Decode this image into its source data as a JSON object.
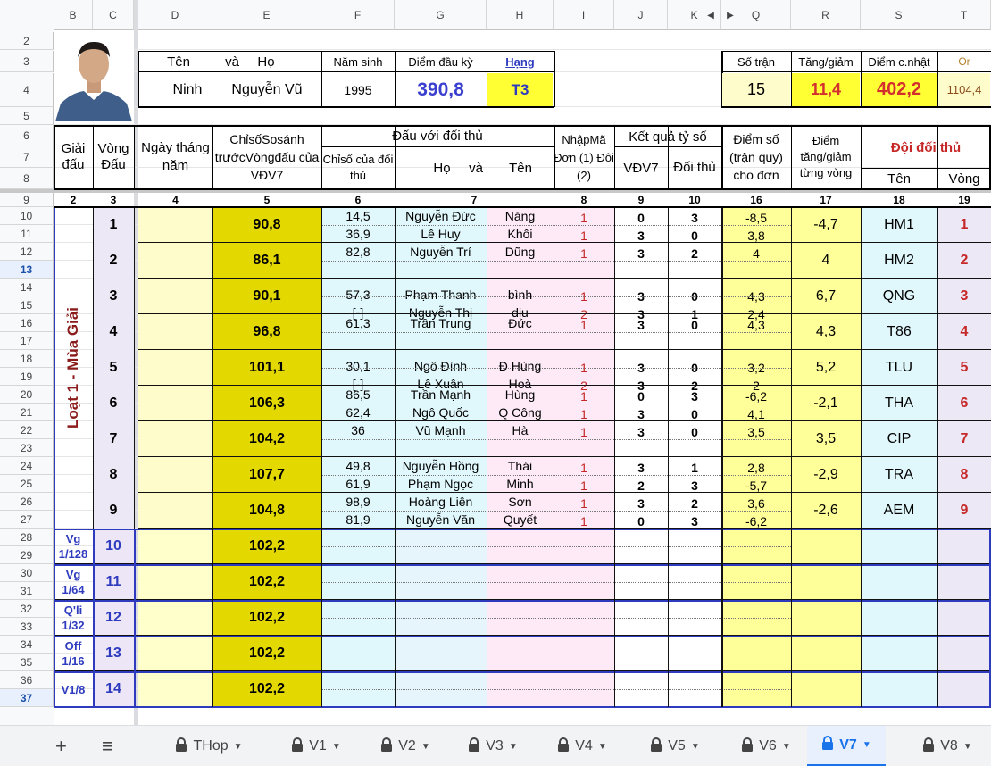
{
  "columns": [
    "B",
    "C",
    "D",
    "E",
    "F",
    "G",
    "H",
    "I",
    "J",
    "K",
    "Q",
    "R",
    "S",
    "T"
  ],
  "rows": [
    "2",
    "3",
    "4",
    "5",
    "6",
    "7",
    "8",
    "9",
    "10",
    "11",
    "12",
    "13",
    "14",
    "15",
    "16",
    "17",
    "18",
    "19",
    "20",
    "21",
    "22",
    "23",
    "24",
    "25",
    "26",
    "27",
    "28",
    "29",
    "30",
    "31",
    "32",
    "33",
    "34",
    "35",
    "36",
    "37"
  ],
  "header": {
    "ten": "Tên",
    "va": "và",
    "ho": "Họ",
    "nam_sinh_label": "Năm sinh",
    "diem_dau_ky_label": "Điểm đầu kỳ",
    "hang_label": "Hạng",
    "first_name": "Ninh",
    "last_name": "Nguyễn Vũ",
    "birth_year": "1995",
    "start_points": "390,8",
    "rank": "T3",
    "so_tran_label": "Số trận",
    "tang_giam_label": "Tăng/giảm",
    "diem_cnhat_label": "Điểm c.nhật",
    "or_label": "Or",
    "so_tran": "15",
    "tang_giam": "11,4",
    "diem_cnhat": "402,2",
    "or_value": "1104,4"
  },
  "table_head": {
    "giai_dau": "Giải đấu",
    "vong_dau": "Vòng Đấu",
    "ngay": "Ngày tháng năm",
    "chiso": "ChỉsốSosánh trướcVòngđấu của VĐV7",
    "dau_voi": "Đấu với đối thủ",
    "chiso_doithu": "Chỉsố của đối thủ",
    "ho": "Họ",
    "va": "và",
    "ten": "Tên",
    "nhapma": "NhậpMã Đơn (1) Đôi (2)",
    "ketqua": "Kết quả tỷ số",
    "vdv7": "VĐV7",
    "doithu": "Đối thủ",
    "diemso": "Điểm số (trận quy) cho đơn",
    "diem_tang": "Điểm tăng/giảm từng vòng",
    "doi_doi_thu": "Đội đối thủ",
    "ten2": "Tên",
    "vong": "Vòng",
    "nums": [
      "2",
      "3",
      "4",
      "5",
      "6",
      "7",
      "8",
      "9",
      "10",
      "16",
      "17",
      "18",
      "19"
    ]
  },
  "season_label": "Loạt 1 - Mùa Giải",
  "rounds": [
    {
      "vong": "1",
      "chiso": "90,8",
      "diem": "-4,7",
      "team": "HM1",
      "vnum": "1",
      "matches": [
        {
          "c": "14,5",
          "ho": "Nguyễn Đức",
          "ten": "Năng",
          "m": "1",
          "a": "0",
          "b": "3",
          "d": "-8,5"
        },
        {
          "c": "36,9",
          "ho": "Lê Huy",
          "ten": "Khôi",
          "m": "1",
          "a": "3",
          "b": "0",
          "d": "3,8"
        }
      ]
    },
    {
      "vong": "2",
      "chiso": "86,1",
      "diem": "4",
      "team": "HM2",
      "vnum": "2",
      "matches": [
        {
          "c": "82,8",
          "ho": "Nguyễn Trí",
          "ten": "Dũng",
          "m": "1",
          "a": "3",
          "b": "2",
          "d": "4"
        }
      ]
    },
    {
      "vong": "3",
      "chiso": "90,1",
      "diem": "6,7",
      "team": "QNG",
      "vnum": "3",
      "matches": [
        {
          "c": "57,3",
          "ho": "Phạm Thanh",
          "ten": "bình",
          "m": "1",
          "a": "3",
          "b": "0",
          "d": "4,3"
        },
        {
          "c": "[-]",
          "ho": "Nguyễn Thị",
          "ten": "dịu",
          "m": "2",
          "a": "3",
          "b": "1",
          "d": "2,4"
        }
      ]
    },
    {
      "vong": "4",
      "chiso": "96,8",
      "diem": "4,3",
      "team": "T86",
      "vnum": "4",
      "matches": [
        {
          "c": "61,3",
          "ho": "Trần Trung",
          "ten": "Đức",
          "m": "1",
          "a": "3",
          "b": "0",
          "d": "4,3"
        }
      ]
    },
    {
      "vong": "5",
      "chiso": "101,1",
      "diem": "5,2",
      "team": "TLU",
      "vnum": "5",
      "matches": [
        {
          "c": "30,1",
          "ho": "Ngô Đình",
          "ten": "Đ Hùng",
          "m": "1",
          "a": "3",
          "b": "0",
          "d": "3,2"
        },
        {
          "c": "[-]",
          "ho": "Lê Xuân",
          "ten": "Hoà",
          "m": "2",
          "a": "3",
          "b": "2",
          "d": "2"
        }
      ]
    },
    {
      "vong": "6",
      "chiso": "106,3",
      "diem": "-2,1",
      "team": "THA",
      "vnum": "6",
      "matches": [
        {
          "c": "86,5",
          "ho": "Trần Mạnh",
          "ten": "Hùng",
          "m": "1",
          "a": "0",
          "b": "3",
          "d": "-6,2"
        },
        {
          "c": "62,4",
          "ho": "Ngô Quốc",
          "ten": "Q Công",
          "m": "1",
          "a": "3",
          "b": "0",
          "d": "4,1"
        }
      ]
    },
    {
      "vong": "7",
      "chiso": "104,2",
      "diem": "3,5",
      "team": "CIP",
      "vnum": "7",
      "matches": [
        {
          "c": "36",
          "ho": "Vũ Mạnh",
          "ten": "Hà",
          "m": "1",
          "a": "3",
          "b": "0",
          "d": "3,5"
        }
      ]
    },
    {
      "vong": "8",
      "chiso": "107,7",
      "diem": "-2,9",
      "team": "TRA",
      "vnum": "8",
      "matches": [
        {
          "c": "49,8",
          "ho": "Nguyễn Hồng",
          "ten": "Thái",
          "m": "1",
          "a": "3",
          "b": "1",
          "d": "2,8"
        },
        {
          "c": "61,9",
          "ho": "Phạm Ngọc",
          "ten": "Minh",
          "m": "1",
          "a": "2",
          "b": "3",
          "d": "-5,7"
        }
      ]
    },
    {
      "vong": "9",
      "chiso": "104,8",
      "diem": "-2,6",
      "team": "AEM",
      "vnum": "9",
      "matches": [
        {
          "c": "98,9",
          "ho": "Hoàng Liên",
          "ten": "Sơn",
          "m": "1",
          "a": "3",
          "b": "2",
          "d": "3,6"
        },
        {
          "c": "81,9",
          "ho": "Nguyễn Văn",
          "ten": "Quyết",
          "m": "1",
          "a": "0",
          "b": "3",
          "d": "-6,2"
        }
      ]
    }
  ],
  "playoffs": [
    {
      "label": "Vg 1/128",
      "vong": "10",
      "chiso": "102,2"
    },
    {
      "label": "Vg 1/64",
      "vong": "11",
      "chiso": "102,2"
    },
    {
      "label": "Q'li 1/32",
      "vong": "12",
      "chiso": "102,2"
    },
    {
      "label": "Off 1/16",
      "vong": "13",
      "chiso": "102,2"
    },
    {
      "label": "V1/8",
      "vong": "14",
      "chiso": "102,2"
    }
  ],
  "tabs": [
    "THop",
    "V1",
    "V2",
    "V3",
    "V4",
    "V5",
    "V6",
    "V7",
    "V8"
  ],
  "active_tab": "V7",
  "colors": {
    "yellow_dark": "#e3d800",
    "yellow": "#fffa9c",
    "light_yellow": "#fffccc",
    "cyan": "#e0f7fb",
    "pink": "#fdeaf6",
    "lavender": "#ede8f6",
    "red": "#c0392b",
    "blue": "#3949ab"
  }
}
